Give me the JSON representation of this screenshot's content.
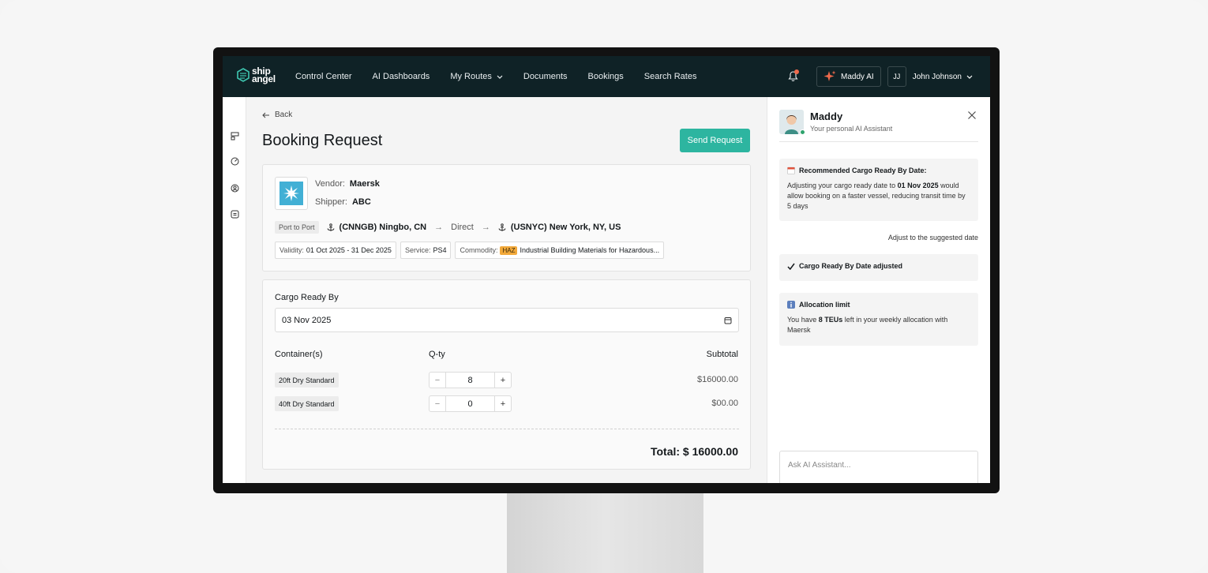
{
  "nav": {
    "logo_line1": "ship",
    "logo_line2": "angel",
    "items": [
      "Control Center",
      "AI Dashboards",
      "My Routes",
      "Documents",
      "Bookings",
      "Search Rates"
    ],
    "maddy_label": "Maddy AI",
    "user_initials": "JJ",
    "user_name": "John Johnson"
  },
  "page": {
    "back_label": "Back",
    "title": "Booking Request",
    "send_label": "Send Request"
  },
  "vendor": {
    "vendor_label": "Vendor:",
    "vendor_value": "Maersk",
    "shipper_label": "Shipper:",
    "shipper_value": "ABC",
    "route_type": "Port to Port",
    "origin": "(CNNGB) Ningbo, CN",
    "mode": "Direct",
    "destination": "(USNYC) New York, NY, US",
    "validity_label": "Validity:",
    "validity_value": "01 Oct 2025 - 31 Dec 2025",
    "service_label": "Service:",
    "service_value": "PS4",
    "commodity_label": "Commodity:",
    "haz_badge": "HAZ",
    "commodity_value": "Industrial Building Materials for Hazardous..."
  },
  "cargo": {
    "ready_label": "Cargo Ready By",
    "ready_value": "03 Nov 2025",
    "col_container": "Container(s)",
    "col_qty": "Q-ty",
    "col_subtotal": "Subtotal",
    "rows": [
      {
        "name": "20ft Dry Standard",
        "qty": "8",
        "subtotal": "$16000.00"
      },
      {
        "name": "40ft Dry Standard",
        "qty": "0",
        "subtotal": "$00.00"
      }
    ],
    "total": "Total: $ 16000.00"
  },
  "ai": {
    "name": "Maddy",
    "subtitle": "Your personal AI Assistant",
    "rec_title": "Recommended Cargo Ready By Date:",
    "rec_text_1": "Adjusting your cargo ready date to ",
    "rec_date": "01 Nov 2025",
    "rec_text_2": " would allow booking on a faster vessel, reducing transit time by 5 days",
    "adjust_label": "Adjust to the suggested date",
    "adjusted_title": "Cargo Ready By Date adjusted",
    "alloc_title": "Allocation limit",
    "alloc_text_1": "You have ",
    "alloc_teus": "8 TEUs",
    "alloc_text_2": " left in your weekly allocation with Maersk",
    "input_placeholder": "Ask AI Assistant..."
  },
  "colors": {
    "nav_bg": "#0f2226",
    "accent": "#2db5a0",
    "haz": "#f2a93b",
    "maersk_blue": "#42b0d5",
    "online": "#2ea36d",
    "notification": "#ef6a4c"
  }
}
